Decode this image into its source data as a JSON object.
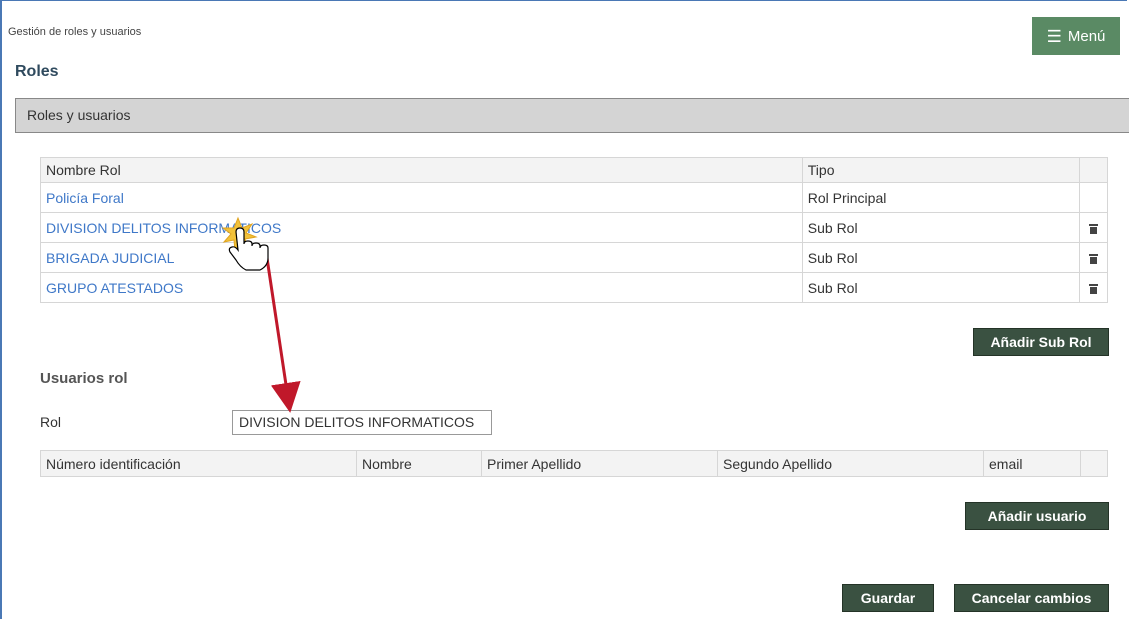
{
  "breadcrumb": "Gestión de roles y usuarios",
  "menu": {
    "label": "Menú",
    "icon": "hamburger-icon"
  },
  "page_title": "Roles",
  "section_title": "Roles y usuarios",
  "roles_table": {
    "headers": {
      "name": "Nombre Rol",
      "type": "Tipo"
    },
    "rows": [
      {
        "name": "Policía Foral",
        "type": "Rol Principal"
      },
      {
        "name": "DIVISION DELITOS INFORMATICOS",
        "type": "Sub Rol"
      },
      {
        "name": "BRIGADA JUDICIAL",
        "type": "Sub Rol"
      },
      {
        "name": "GRUPO ATESTADOS",
        "type": "Sub Rol"
      }
    ]
  },
  "add_sub_role_label": "Añadir Sub Rol",
  "users_section": {
    "title": "Usuarios rol",
    "role_label": "Rol",
    "role_value": "DIVISION DELITOS INFORMATICOS",
    "headers": {
      "id": "Número identificación",
      "name": "Nombre",
      "surname1": "Primer Apellido",
      "surname2": "Segundo Apellido",
      "email": "email"
    }
  },
  "add_user_label": "Añadir usuario",
  "save_label": "Guardar",
  "cancel_label": "Cancelar cambios",
  "colors": {
    "link": "#3f78c8",
    "button": "#3a5141",
    "menu": "#5a8a64",
    "arrow": "#c0182a"
  }
}
